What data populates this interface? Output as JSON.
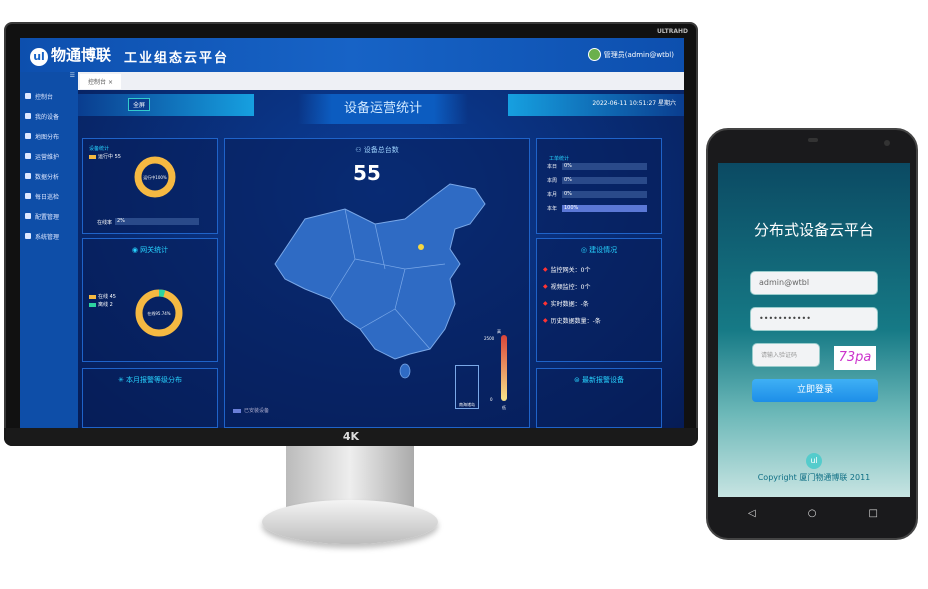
{
  "monitor": {
    "badge": "ULTRAHD",
    "chin_label": "4K"
  },
  "header": {
    "logo_icon": "wl-logo",
    "brand": "物通博联",
    "platform": "工业组态云平台",
    "user": "管理员(admin@wtbl)"
  },
  "sidebar": {
    "items": [
      {
        "label": "控制台",
        "icon": "home-icon"
      },
      {
        "label": "我的设备",
        "icon": "device-icon"
      },
      {
        "label": "地图分布",
        "icon": "map-icon"
      },
      {
        "label": "运营维护",
        "icon": "tool-icon"
      },
      {
        "label": "数据分析",
        "icon": "chart-icon"
      },
      {
        "label": "每日巡检",
        "icon": "list-icon"
      },
      {
        "label": "配置管理",
        "icon": "config-icon"
      },
      {
        "label": "系统管理",
        "icon": "gear-icon"
      }
    ]
  },
  "tabs": [
    {
      "label": "控制台"
    }
  ],
  "dashboard": {
    "title": "设备运营统计",
    "fullscreen": "全屏",
    "datetime": "2022-06-11 10:51:27 星期六",
    "device_stats": {
      "title": "设备统计",
      "legend": "运行中 55",
      "center": "运行中100%",
      "rate_label": "在线率",
      "rate_value": "2%",
      "rate": 2
    },
    "gateway_stats": {
      "title": "网关统计",
      "online": {
        "label": "在线 45",
        "value": 45,
        "color": "#f5b942"
      },
      "offline": {
        "label": "离线 2",
        "value": 2,
        "color": "#2ed3a0"
      },
      "center": "在线95.74%"
    },
    "alarm_level": {
      "title": "本月报警等级分布"
    },
    "total": {
      "title": "设备总台数",
      "value": "55"
    },
    "map": {
      "legend": "已安装设备",
      "scale_max": "2500",
      "scale_min": "0",
      "scale_high": "高",
      "scale_low": "低",
      "inset": "南海诸岛"
    },
    "work_orders": {
      "title": "工单统计",
      "rows": [
        {
          "label": "本日",
          "value": "0%",
          "pct": 0
        },
        {
          "label": "本周",
          "value": "0%",
          "pct": 0
        },
        {
          "label": "本月",
          "value": "0%",
          "pct": 0
        },
        {
          "label": "本年",
          "value": "100%",
          "pct": 100
        }
      ]
    },
    "construction": {
      "title": "建设情况",
      "rows": [
        "监控网关：0个",
        "视频监控：0个",
        "实时数据：-条",
        "历史数据数量：-条"
      ]
    },
    "latest_alarm": {
      "title": "最新报警设备"
    }
  },
  "phone": {
    "title": "分布式设备云平台",
    "username": "admin@wtbl",
    "password": "•••••••••••",
    "captcha_placeholder": "请输入验证码",
    "captcha": "73pa",
    "login": "立即登录",
    "copyright": "Copyright 厦门物通博联 2011"
  }
}
